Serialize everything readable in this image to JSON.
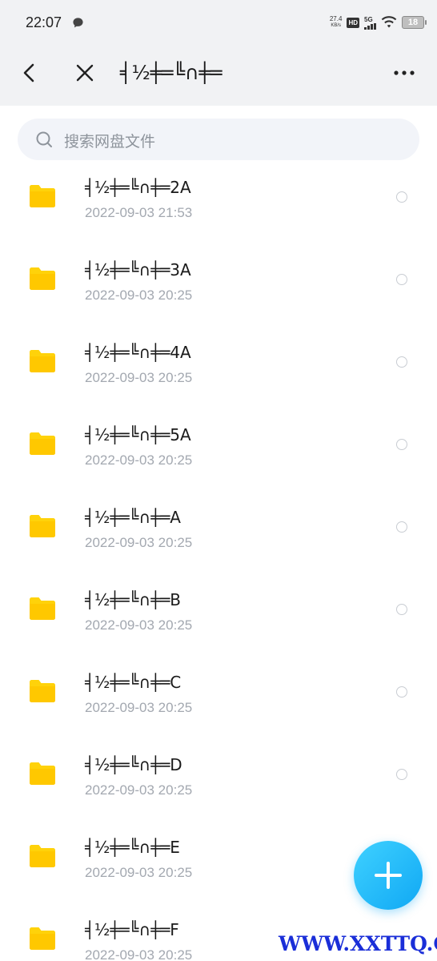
{
  "status_bar": {
    "time": "22:07",
    "net_speed_value": "27.4",
    "net_speed_unit": "KB/s",
    "hd_label": "HD",
    "network_label": "5G",
    "battery_level": "18"
  },
  "title_bar": {
    "title": "╡½╪═╚∩╪═"
  },
  "search": {
    "placeholder": "搜索网盘文件"
  },
  "files": [
    {
      "name": "╡½╪═╚∩╪═2A",
      "date": "2022-09-03  21:53"
    },
    {
      "name": "╡½╪═╚∩╪═3A",
      "date": "2022-09-03  20:25"
    },
    {
      "name": "╡½╪═╚∩╪═4A",
      "date": "2022-09-03  20:25"
    },
    {
      "name": "╡½╪═╚∩╪═5A",
      "date": "2022-09-03  20:25"
    },
    {
      "name": "╡½╪═╚∩╪═A",
      "date": "2022-09-03  20:25"
    },
    {
      "name": "╡½╪═╚∩╪═B",
      "date": "2022-09-03  20:25"
    },
    {
      "name": "╡½╪═╚∩╪═C",
      "date": "2022-09-03  20:25"
    },
    {
      "name": "╡½╪═╚∩╪═D",
      "date": "2022-09-03  20:25"
    },
    {
      "name": "╡½╪═╚∩╪═E",
      "date": "2022-09-03  20:25"
    },
    {
      "name": "╡½╪═╚∩╪═F",
      "date": "2022-09-03  20:25"
    }
  ],
  "icons": {
    "back": "chevron-left-icon",
    "close": "close-icon",
    "more": "more-horizontal-icon",
    "search": "search-icon",
    "folder": "folder-icon",
    "add": "plus-icon"
  },
  "colors": {
    "folder": "#ffd20a",
    "fab": "#1ab3f8",
    "watermark": "#1a2ed8"
  },
  "watermark": "WWW.XXTTQ.COM"
}
